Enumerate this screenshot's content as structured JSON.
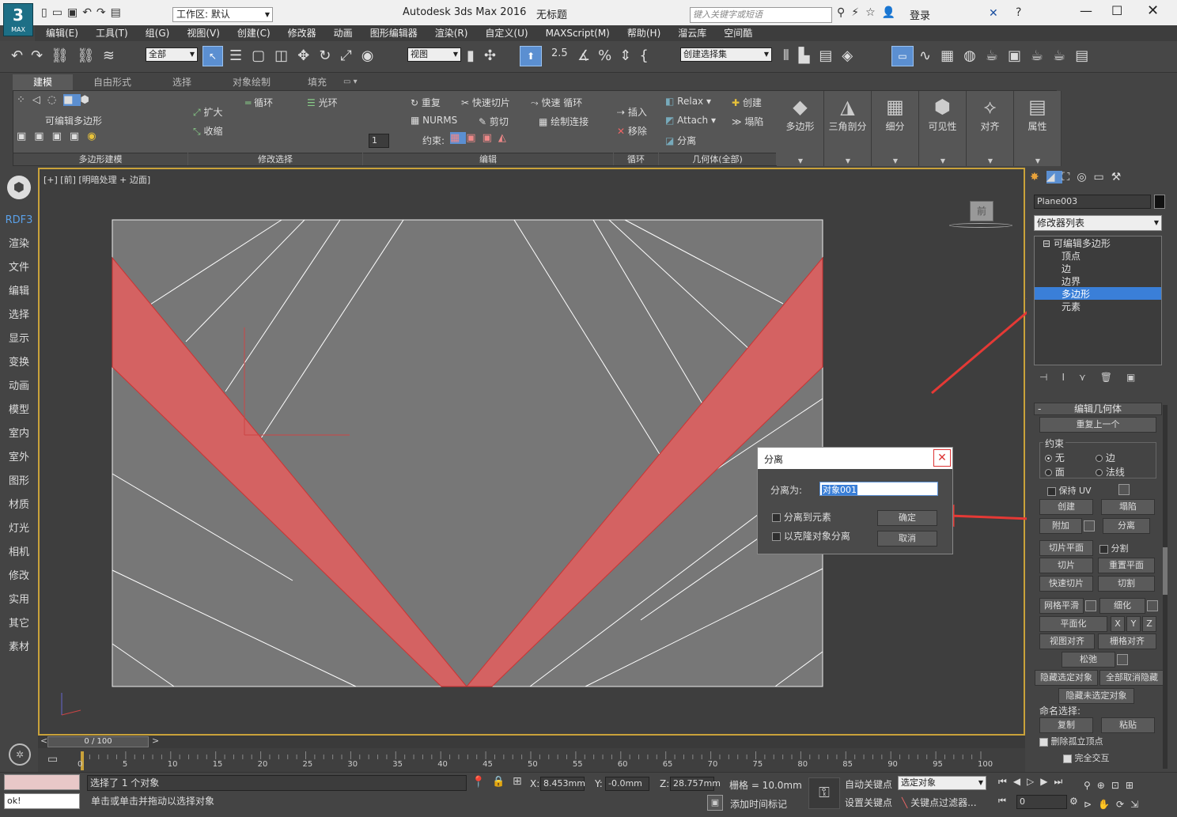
{
  "titlebar": {
    "app_title": "Autodesk 3ds Max 2016",
    "doc_title": "无标题",
    "workspace": "工作区: 默认",
    "search_placeholder": "键入关键字或短语",
    "login": "登录",
    "logo_text": "MAX"
  },
  "menu": [
    "编辑(E)",
    "工具(T)",
    "组(G)",
    "视图(V)",
    "创建(C)",
    "修改器",
    "动画",
    "图形编辑器",
    "渲染(R)",
    "自定义(U)",
    "MAXScript(M)",
    "帮助(H)",
    "溜云库",
    "空间酷"
  ],
  "toolbar": {
    "filter": "全部",
    "refcoord": "视图",
    "selset": "创建选择集",
    "snap_value": "2.5"
  },
  "ribbon_tabs": [
    "建模",
    "自由形式",
    "选择",
    "对象绘制",
    "填充"
  ],
  "ribbon": {
    "polymodel_label": "可编辑多边形",
    "expand": "扩大",
    "shrink": "收缩",
    "loop": "循环",
    "ring": "光环",
    "repeat": "重复",
    "quickslice": "快速切片",
    "quickloop": "快速 循环",
    "nurms": "NURMS",
    "cut": "剪切",
    "paintconnect": "绘制连接",
    "constraint": "约束:",
    "insert": "插入",
    "remove": "移除",
    "relax": "Relax",
    "create": "创建",
    "attach": "Attach",
    "collapse": "塌陷",
    "detach": "分离",
    "spinner_val": "1",
    "big_buttons": [
      "多边形",
      "三角剖分",
      "细分",
      "可见性",
      "对齐",
      "属性"
    ],
    "groups": [
      "多边形建模",
      "修改选择",
      "编辑",
      "循环",
      "几何体(全部)"
    ]
  },
  "left_panel": [
    "RDF3",
    "渲染",
    "文件",
    "编辑",
    "选择",
    "显示",
    "变换",
    "动画",
    "模型",
    "室内",
    "室外",
    "图形",
    "材质",
    "灯光",
    "相机",
    "修改",
    "实用",
    "其它",
    "素材"
  ],
  "viewport": {
    "label": "[+] [前] [明暗处理 + 边面]",
    "cube_label": "前"
  },
  "dialog": {
    "title": "分离",
    "name_label": "分离为:",
    "name_value": "对象001",
    "opt1": "分离到元素",
    "opt2": "以克隆对象分离",
    "ok": "确定",
    "cancel": "取消"
  },
  "cmdpanel": {
    "object_name": "Plane003",
    "modlist": "修改器列表",
    "stack": [
      "可编辑多边形",
      "顶点",
      "边",
      "边界",
      "多边形",
      "元素"
    ],
    "rollout_title": "编辑几何体",
    "repeat_last": "重复上一个",
    "constraints": "约束",
    "c_none": "无",
    "c_edge": "边",
    "c_face": "面",
    "c_normal": "法线",
    "preserve_uv": "保持 UV",
    "create": "创建",
    "collapse": "塌陷",
    "attach": "附加",
    "detach": "分离",
    "sliceplane": "切片平面",
    "split": "分割",
    "slice": "切片",
    "resetplane": "重置平面",
    "quickslice": "快速切片",
    "cut": "切割",
    "meshsmooth": "网格平滑",
    "tessellate": "细化",
    "planarize": "平面化",
    "x": "X",
    "y": "Y",
    "z": "Z",
    "viewalign": "视图对齐",
    "gridalign": "栅格对齐",
    "relax": "松弛",
    "hidesel": "隐藏选定对象",
    "unhideall": "全部取消隐藏",
    "hideunsel": "隐藏未选定对象",
    "namedsel": "命名选择:",
    "copy": "复制",
    "paste": "粘贴",
    "delisolated": "删除孤立顶点",
    "fullinteract": "完全交互"
  },
  "timeline": {
    "frame": "0 / 100",
    "ticks": [
      "0",
      "5",
      "10",
      "15",
      "20",
      "25",
      "30",
      "35",
      "40",
      "45",
      "50",
      "55",
      "60",
      "65",
      "70",
      "75",
      "80",
      "85",
      "90",
      "95",
      "100"
    ]
  },
  "status": {
    "script_out": "ok!",
    "selected": "选择了 1 个对象",
    "prompt": "单击或单击并拖动以选择对象",
    "x_label": "X:",
    "x": "8.453mm",
    "y_label": "Y:",
    "y": "-0.0mm",
    "z_label": "Z:",
    "z": "28.757mm",
    "grid": "栅格 = 10.0mm",
    "addtime": "添加时间标记",
    "autokey": "自动关键点",
    "setkey": "设置关键点",
    "selobj": "选定对象",
    "keyfilter": "关键点过滤器...",
    "frame_field": "0"
  },
  "colors": {
    "accent": "#3a7fd8",
    "selection": "#d46262",
    "highlight": "#e53935",
    "viewport_bg": "#777777"
  }
}
